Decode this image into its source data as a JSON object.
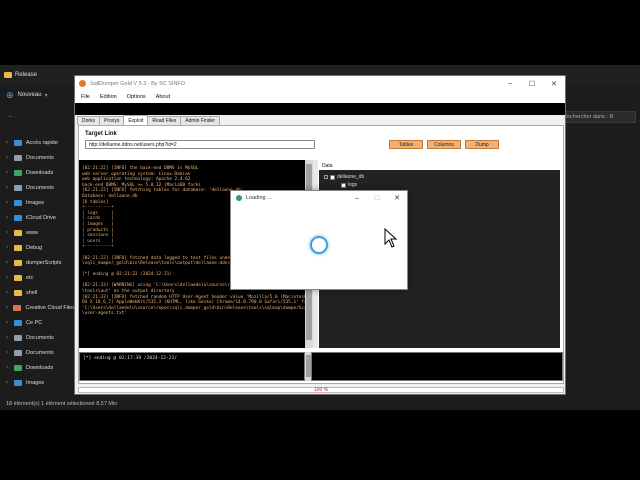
{
  "explorer": {
    "title": "Release",
    "new_label": "Nouveau",
    "search_placeholder": "Rechercher dans : R",
    "sidebar": [
      {
        "label": "Accès rapide",
        "icon": "star-icon",
        "color": "#3c8ad8"
      },
      {
        "label": "Documents",
        "icon": "documents-icon",
        "color": "#8aa0b0"
      },
      {
        "label": "Downloads",
        "icon": "download-icon",
        "color": "#3aa860"
      },
      {
        "label": "Documents",
        "icon": "documents-icon",
        "color": "#8aa0b0"
      },
      {
        "label": "Images",
        "icon": "images-icon",
        "color": "#3c8ad8"
      },
      {
        "label": "iCloud Drive",
        "icon": "cloud-icon",
        "color": "#3c8ad8"
      },
      {
        "label": "www",
        "icon": "folder-icon",
        "color": "#e8b84a"
      },
      {
        "label": "Debug",
        "icon": "folder-icon",
        "color": "#e8b84a"
      },
      {
        "label": "dumperScripts",
        "icon": "folder-icon",
        "color": "#e8b84a"
      },
      {
        "label": "etc",
        "icon": "folder-icon",
        "color": "#e8b84a"
      },
      {
        "label": "shell",
        "icon": "folder-icon",
        "color": "#e8b84a"
      },
      {
        "label": "Creative Cloud Files",
        "icon": "cloud-icon",
        "color": "#e07050"
      },
      {
        "label": "Ce PC",
        "icon": "pc-icon",
        "color": "#3c8ad8"
      },
      {
        "label": "Documents",
        "icon": "documents-icon",
        "color": "#8aa0b0"
      },
      {
        "label": "Documents",
        "icon": "documents-icon",
        "color": "#8aa0b0"
      },
      {
        "label": "Downloads",
        "icon": "download-icon",
        "color": "#3aa860"
      },
      {
        "label": "Images",
        "icon": "images-icon",
        "color": "#3c8ad8"
      }
    ],
    "status": "18 élément(s)    1 élément sélectionné  8,57 Mio"
  },
  "sqli": {
    "title": "SqliDumper Gold V 5.3  -  By SC SINFO",
    "menu": [
      "File",
      "Edition",
      "Options",
      "About"
    ],
    "tabs": [
      "Dorks",
      "Proxys",
      "Exploit",
      "Read Files",
      "Admin Finder"
    ],
    "active_tab": "Exploit",
    "target_label": "Target Link",
    "target_url": "http://dellaone.ddns.net/users.php?id=2",
    "buttons": {
      "tables": "Tables",
      "columns": "Columns",
      "dump": "Dump"
    },
    "log_lines": [
      "[02:21:22] [INFO] the back-end DBMS is MySQL",
      "web server operating system: Linux Debian",
      "web application technology: Apache 2.4.62",
      "back-end DBMS: MySQL >= 5.0.12 (MariaDB fork)",
      "[02:21:22] [INFO] fetching tables for database: 'dellaone_db'",
      "Database: dellaone_db",
      "[6 tables]",
      "+----------+",
      "| logs     |",
      "| cards    |",
      "| images   |",
      "| products |",
      "| sessions |",
      "| users    |",
      "+----------+",
      "",
      "[02:21:22] [INFO] fetched data logged to text files under 'C:\\Users\\d",
      "\\sqli_dumper_gold\\bin\\Release\\tools\\output\\dellaone.ddns.net'",
      "",
      "[*] ending @ 02:21:22 /2024-12-21/",
      "",
      "[02:21:33] [WARNING] using 'C:\\Users\\dellaedelu\\source\\repos\\sqli_dumper_gold\\bin\\Release",
      "\\tools\\out' as the output directory",
      "[02:21:33] [INFO] fetched random HTTP User-Agent header value 'Mozilla/5.0 (Macintosh; Intel Mac",
      "OS X 10_6_7) AppleWebKit/535.1 (KHTML, like Gecko) Chrome/14.0.790.0 Safari/535.1' from file",
      "'C:\\Users\\dellaedelu\\source\\repos\\sqli_dumper_gold\\bin\\Release\\tools\\sqlmap\\dumperScripts\\data\\txt",
      "\\user-agents.txt'"
    ],
    "data_label": "Data",
    "tree": {
      "db": "dellaone_db",
      "table": "logs"
    },
    "cmd_output": "[*] ending @ 02:17:39 /2024-12-21/",
    "progress_text": "100 %",
    "progress_fraction": 1.0
  },
  "loading": {
    "title": "Loading ..."
  }
}
